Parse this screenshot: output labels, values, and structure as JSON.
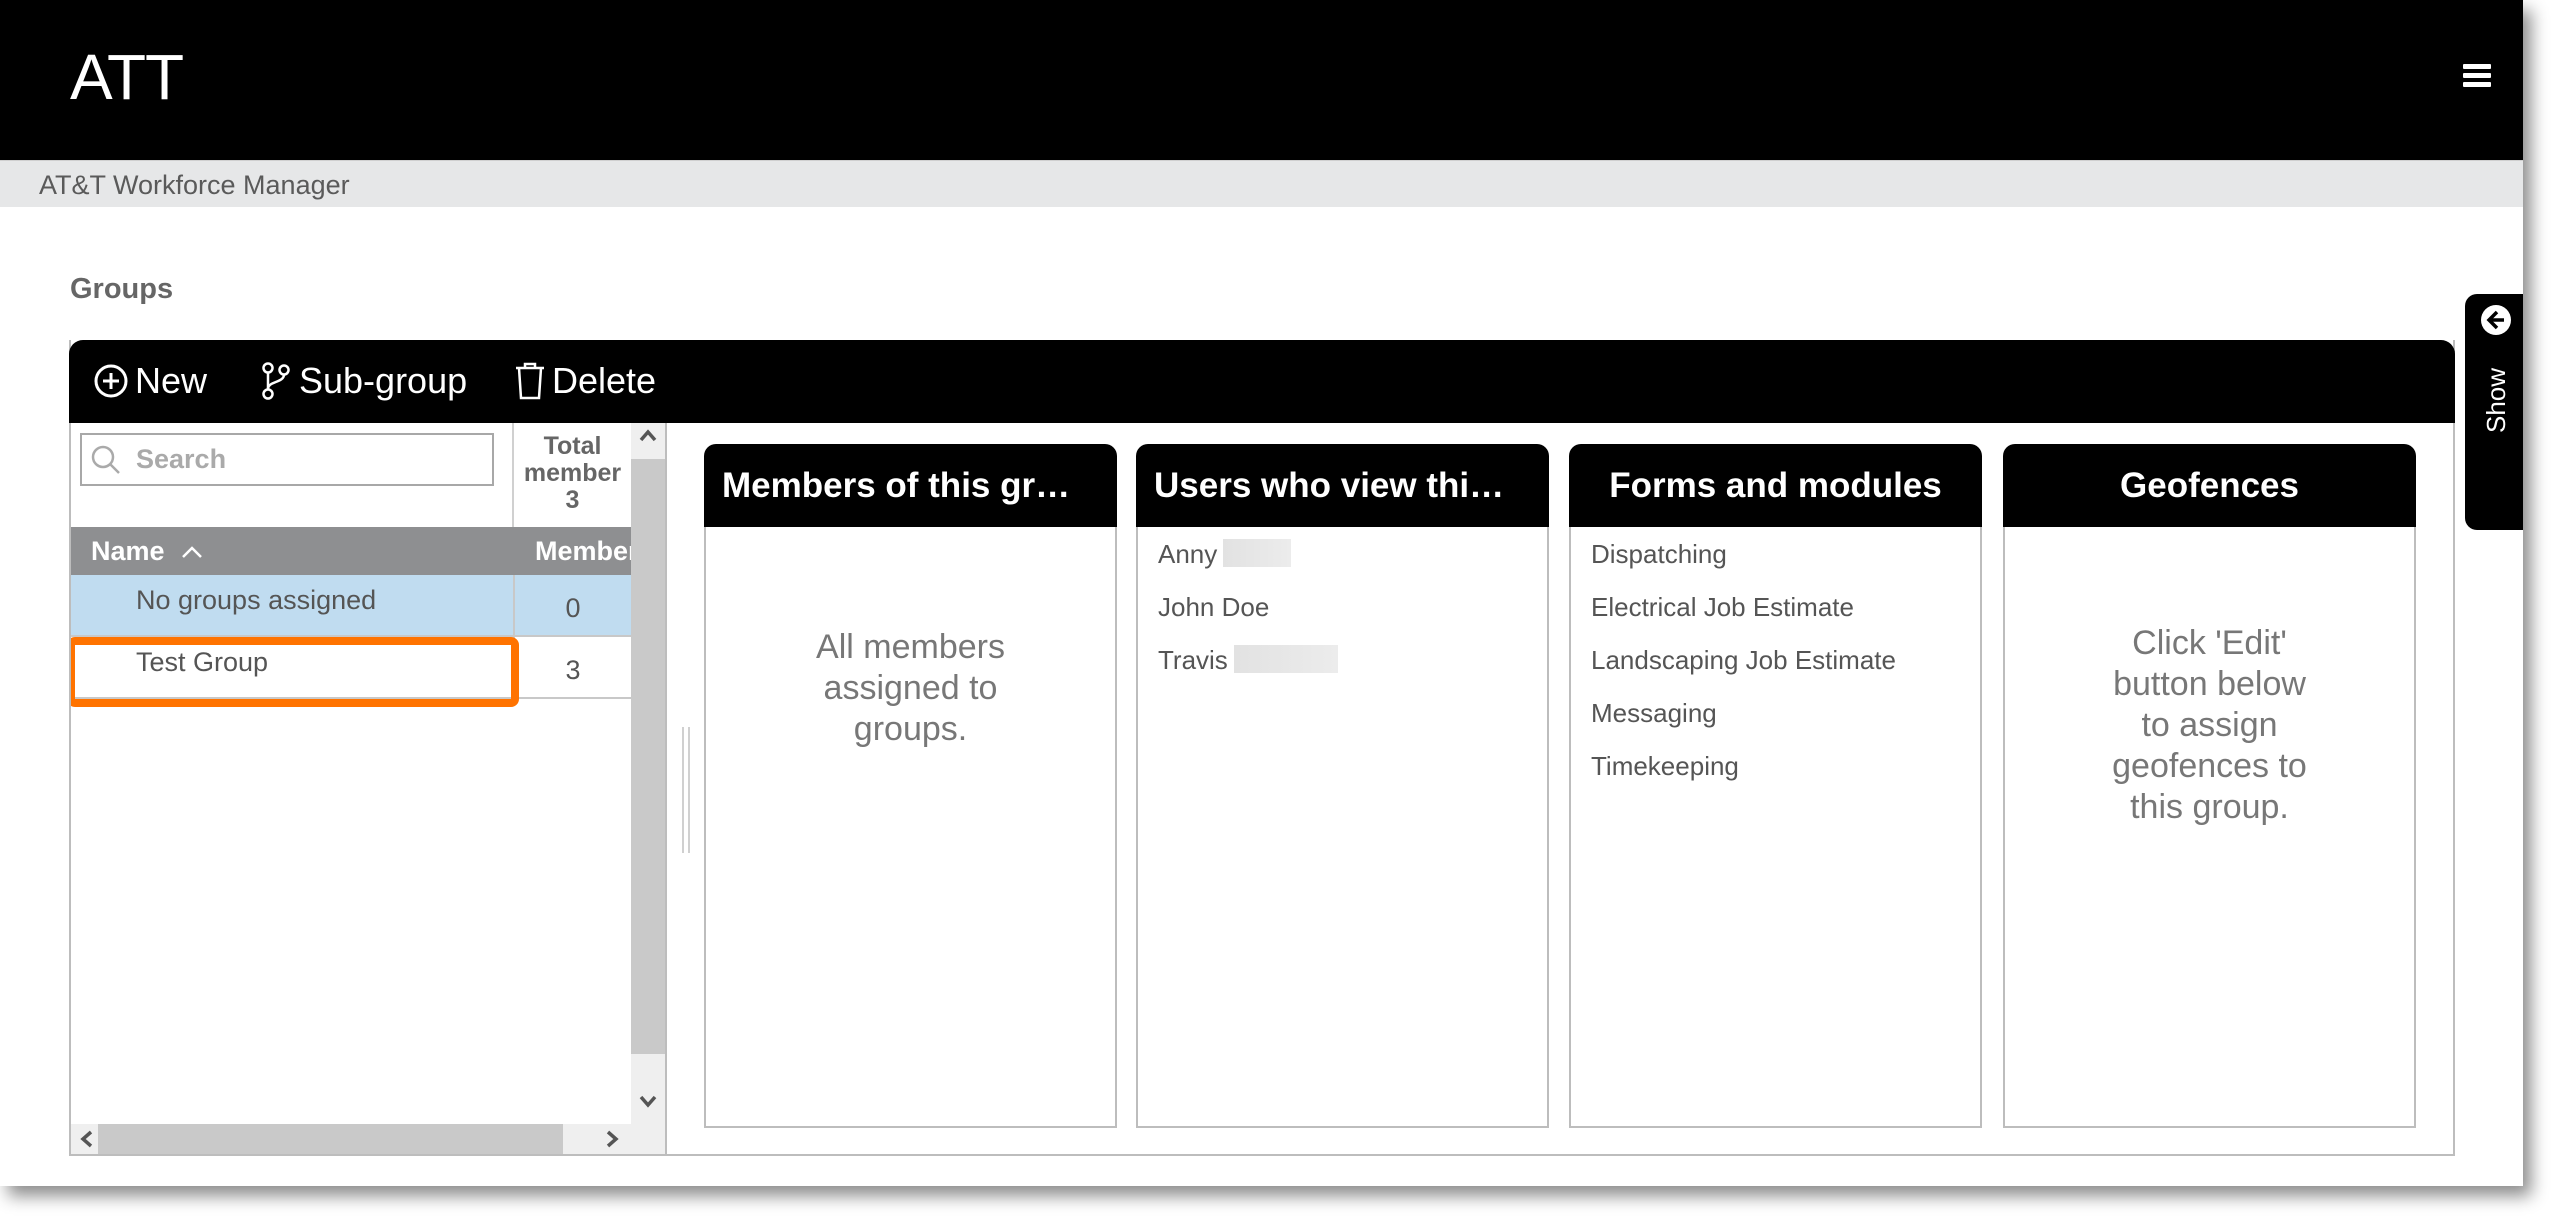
{
  "header": {
    "app_title": "ATT",
    "menu_icon": "hamburger-menu-icon",
    "subtitle": "AT&T Workforce Manager"
  },
  "page": {
    "title": "Groups"
  },
  "toolbar": {
    "new_label": "New",
    "subgroup_label": "Sub-group",
    "delete_label": "Delete"
  },
  "groups_list": {
    "search_placeholder": "Search",
    "search_value": "",
    "total_members_label_line1": "Total",
    "total_members_label_line2": "member",
    "total_members_value": "3",
    "columns": {
      "name": "Name",
      "name_sort": "ascending",
      "members": "Member"
    },
    "rows": [
      {
        "name": "No groups assigned",
        "members": "0",
        "selected": true
      },
      {
        "name": "Test Group",
        "members": "3",
        "selected": false,
        "highlighted": true
      }
    ]
  },
  "panels": {
    "members": {
      "title": "Members of this gr…",
      "empty_message_line1": "All members",
      "empty_message_line2": "assigned to",
      "empty_message_line3": "groups."
    },
    "viewers": {
      "title": "Users who view thi…",
      "users": [
        {
          "name": "Anny",
          "redacted": true
        },
        {
          "name": "John Doe",
          "redacted": false
        },
        {
          "name": "Travis",
          "redacted": true
        }
      ]
    },
    "forms": {
      "title": "Forms and modules",
      "items": [
        "Dispatching",
        "Electrical Job Estimate",
        "Landscaping Job Estimate",
        "Messaging",
        "Timekeeping"
      ]
    },
    "geofences": {
      "title": "Geofences",
      "message_line1": "Click 'Edit'",
      "message_line2": "button below",
      "message_line3": "to assign",
      "message_line4": "geofences to",
      "message_line5": "this group."
    }
  },
  "side_tab": {
    "label": "Show",
    "icon": "arrow-left-circle-icon"
  },
  "colors": {
    "highlight": "#ff7300",
    "selected_row": "#c0dcf0",
    "grid_header": "#8e8f91",
    "toolbar": "#000000"
  }
}
